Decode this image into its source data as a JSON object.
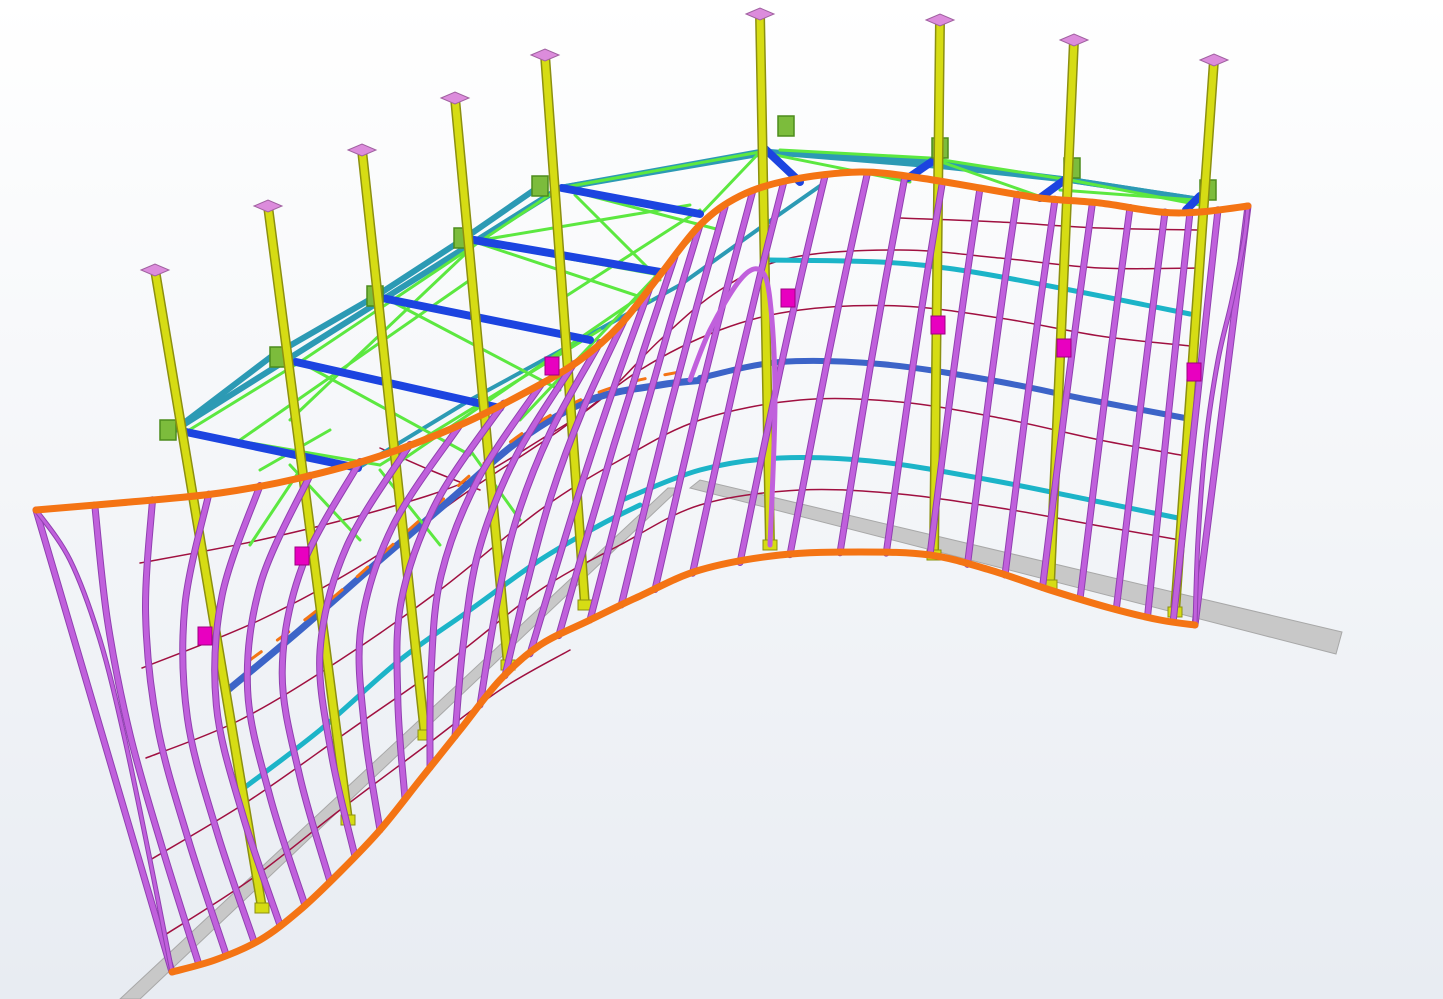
{
  "viewport": {
    "title": "",
    "background_top": "#ffffff",
    "background_bottom": "#e8ecf2"
  },
  "colors": {
    "column": "#d6dc14",
    "column_outline": "#8c9010",
    "base_plate": "#dc8cdc",
    "plate": "#7cbc3c",
    "plate_dark": "#4c8c1c",
    "top_chord": "#2c9ab4",
    "cross_beam": "#1c44e0",
    "bracing": "#5ce840",
    "rib": "#c060dc",
    "rib_outline": "#9040b0",
    "edge_beam": "#f47414",
    "rail_teal": "#1cb4c8",
    "rail_blue": "#3c64c8",
    "rail_orange": "#f47414",
    "tie": "#a01040",
    "bracket": "#e800c0",
    "ground": "#c8c8c8",
    "ground_dark": "#a8a8a8"
  },
  "structure": {
    "columns": 9,
    "ribs": 33,
    "cross_beams": 7,
    "brackets": 7,
    "rails": 6,
    "ties": 7,
    "ground_beams": 2
  }
}
